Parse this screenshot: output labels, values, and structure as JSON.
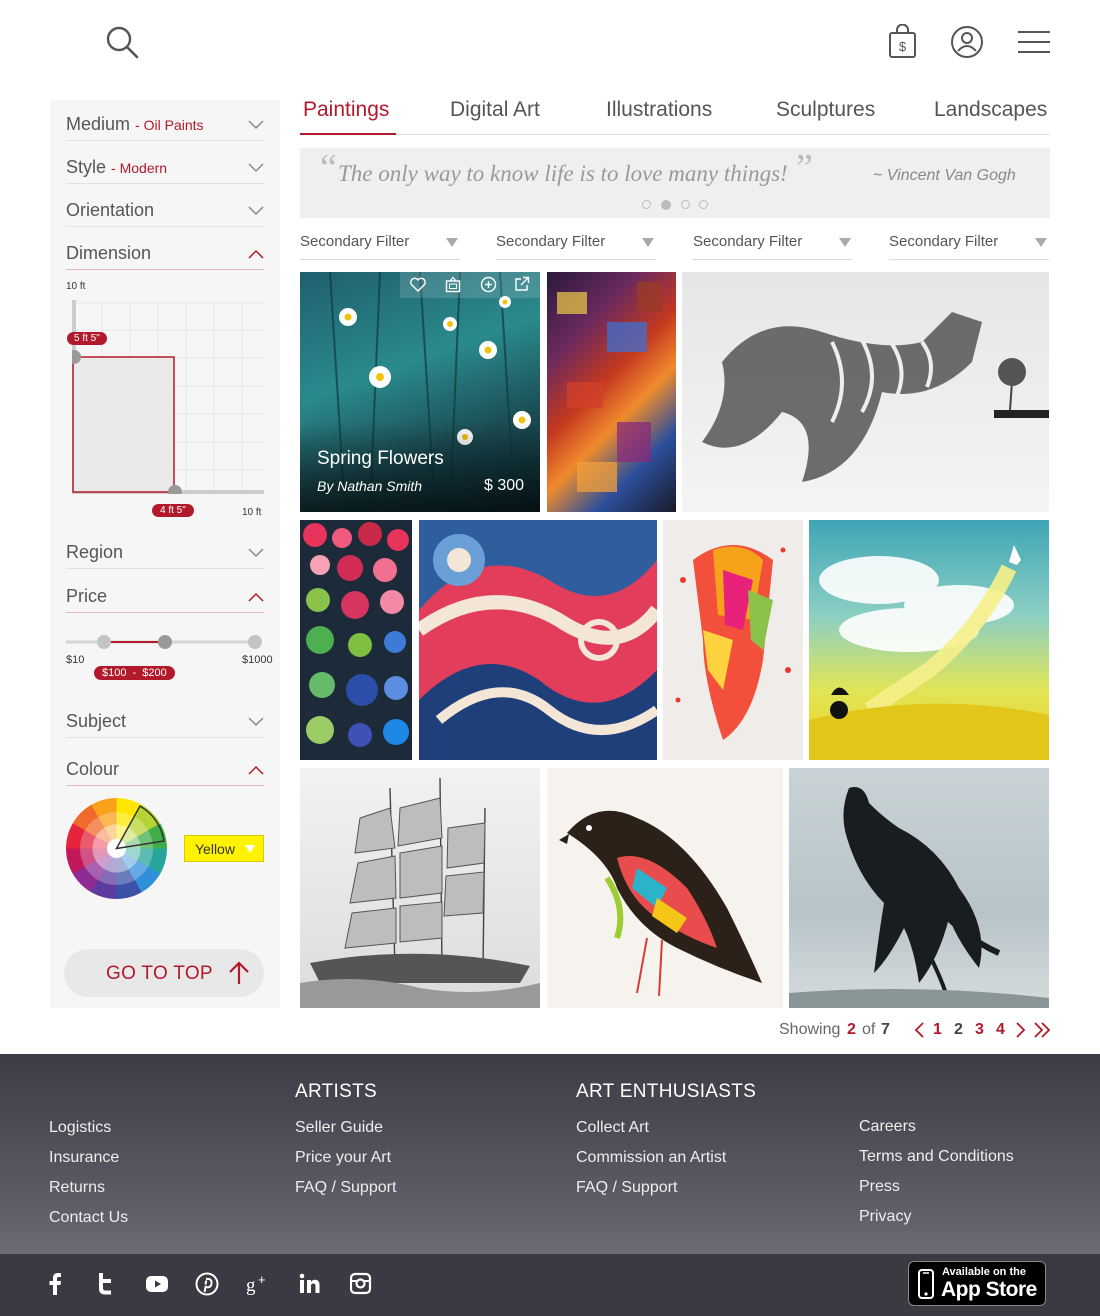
{
  "header": {
    "search_icon": "search-icon",
    "cart_icon": "shopping-bag-dollar-icon",
    "user_icon": "user-account-icon",
    "menu_icon": "hamburger-menu-icon"
  },
  "sidebar": {
    "medium": {
      "label": "Medium",
      "value": "Oil Paints"
    },
    "style": {
      "label": "Style",
      "value": "Modern"
    },
    "orientation": {
      "label": "Orientation"
    },
    "dimension": {
      "label": "Dimension",
      "height_max": "10 ft",
      "width_max": "10 ft",
      "height_value": "5 ft 5\"",
      "width_value": "4 ft 5\""
    },
    "region": {
      "label": "Region"
    },
    "price": {
      "label": "Price",
      "min": "$10",
      "max": "$1000",
      "range_low": "$100",
      "range_sep": "-",
      "range_high": "$200"
    },
    "subject": {
      "label": "Subject"
    },
    "colour": {
      "label": "Colour",
      "selected": "Yellow"
    },
    "go_to_top": "GO TO TOP"
  },
  "tabs": [
    {
      "label": "Paintings",
      "active": true
    },
    {
      "label": "Digital Art"
    },
    {
      "label": "Illustrations"
    },
    {
      "label": "Sculptures"
    },
    {
      "label": "Landscapes"
    }
  ],
  "quote": {
    "text": "The only way to know life is to love many things!",
    "author": "~ Vincent Van Gogh",
    "dots": 4,
    "active_dot": 2
  },
  "filters": [
    "Secondary Filter",
    "Secondary Filter",
    "Secondary Filter",
    "Secondary Filter"
  ],
  "featured": {
    "title": "Spring Flowers",
    "artist": "By Nathan Smith",
    "price": "$ 300",
    "actions": [
      "heart-icon",
      "frame-icon",
      "add-circle-icon",
      "external-link-icon"
    ]
  },
  "pagination": {
    "showing_label": "Showing",
    "current": "2",
    "of_label": "of",
    "total": "7",
    "pages": [
      "1",
      "2",
      "3",
      "4"
    ]
  },
  "footer": {
    "col1": {
      "heading": "",
      "links": [
        "Logistics",
        "Insurance",
        "Returns",
        "Contact Us"
      ]
    },
    "col2": {
      "heading": "ARTISTS",
      "links": [
        "Seller Guide",
        "Price your Art",
        "FAQ / Support"
      ]
    },
    "col3": {
      "heading": "ART ENTHUSIASTS",
      "links": [
        "Collect Art",
        "Commission an Artist",
        "FAQ / Support"
      ]
    },
    "col4": {
      "heading": "",
      "links": [
        "Careers",
        "Terms and Conditions",
        "Press",
        "Privacy"
      ]
    },
    "social": [
      "facebook-icon",
      "twitter-icon",
      "youtube-icon",
      "pinterest-icon",
      "google-plus-icon",
      "linkedin-icon",
      "instagram-icon"
    ],
    "appstore_small": "Available on the",
    "appstore_big": "App Store"
  },
  "colors": {
    "accent": "#b21a2b",
    "sidebar_bg": "#f6f6f6",
    "footer": "#3a3b42",
    "yellow": "#fff200"
  }
}
